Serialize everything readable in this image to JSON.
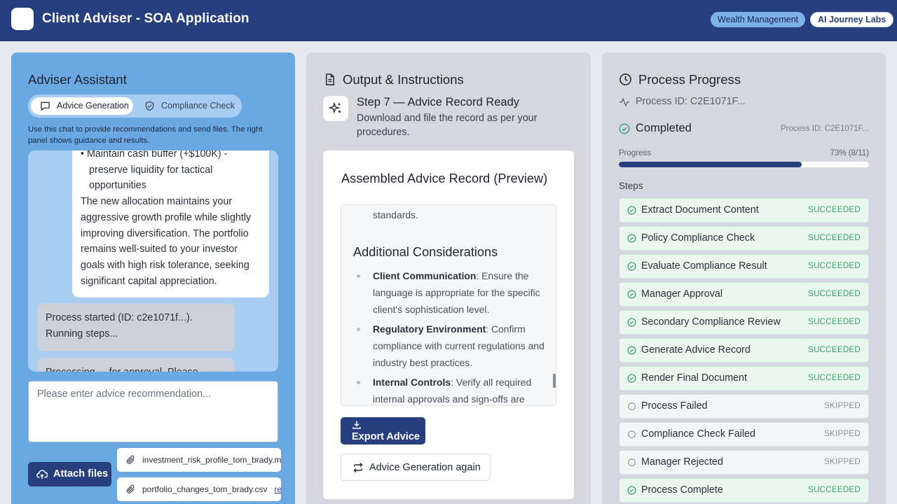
{
  "header": {
    "title": "Client Adviser - SOA Application",
    "badges": [
      "Wealth Management",
      "AI Journey Labs"
    ]
  },
  "left": {
    "title": "Adviser Assistant",
    "tabs": [
      {
        "label": "Advice Generation",
        "icon": "chat-icon",
        "active": true
      },
      {
        "label": "Compliance Check",
        "icon": "shield-icon",
        "active": false
      }
    ],
    "help": "Use this chat to provide recommendations and send files. The right panel shows guidance and results.",
    "chat": {
      "assistant_lines": [
        "• Maintain cash buffer (+$100K) - preserve liquidity for tactical opportunities",
        "The new allocation maintains your aggressive growth profile while slightly improving diversification. The portfolio remains well-suited to your investor goals with high risk tolerance, seeking significant capital appreciation."
      ],
      "user_messages": [
        "Process started (ID: c2e1071f...). Running steps...",
        "Processing ... for approval. Please"
      ]
    },
    "input_placeholder": "Please enter advice recommendation...",
    "attach_label": "Attach files",
    "files": [
      {
        "name": "investment_risk_profile_tom_brady.md",
        "action": ""
      },
      {
        "name": "portfolio_changes_tom_brady.csv",
        "action": "remove"
      }
    ]
  },
  "middle": {
    "title": "Output & Instructions",
    "step_title": "Step 7 — Advice Record Ready",
    "step_desc": "Download and file the record as per your procedures.",
    "record_title": "Assembled Advice Record (Preview)",
    "preview": {
      "lead": "standards.",
      "heading": "Additional Considerations",
      "items": [
        {
          "term": "Client Communication",
          "text": ": Ensure the language is appropriate for the specific client's sophistication level."
        },
        {
          "term": "Regulatory Environment",
          "text": ": Confirm compliance with current regulations and industry best practices."
        },
        {
          "term": "Internal Controls",
          "text": ": Verify all required internal approvals and sign-offs are"
        }
      ]
    },
    "export_label": "Export Advice",
    "again_label": "Advice Generation again"
  },
  "right": {
    "title": "Process Progress",
    "process_id": "Process ID: C2E1071F...",
    "status": "Completed",
    "status_id": "Process ID: C2E1071F...",
    "progress_label": "Progress",
    "progress_text": "73% (8/11)",
    "progress_fraction": 0.73,
    "steps_label": "Steps",
    "steps": [
      {
        "name": "Extract Document Content",
        "state": "SUCCEEDED"
      },
      {
        "name": "Policy Compliance Check",
        "state": "SUCCEEDED"
      },
      {
        "name": "Evaluate Compliance Result",
        "state": "SUCCEEDED"
      },
      {
        "name": "Manager Approval",
        "state": "SUCCEEDED"
      },
      {
        "name": "Secondary Compliance Review",
        "state": "SUCCEEDED"
      },
      {
        "name": "Generate Advice Record",
        "state": "SUCCEEDED"
      },
      {
        "name": "Render Final Document",
        "state": "SUCCEEDED"
      },
      {
        "name": "Process Failed",
        "state": "SKIPPED"
      },
      {
        "name": "Compliance Check Failed",
        "state": "SKIPPED"
      },
      {
        "name": "Manager Rejected",
        "state": "SKIPPED"
      },
      {
        "name": "Process Complete",
        "state": "SUCCEEDED"
      }
    ]
  },
  "colors": {
    "header": "#283f7f",
    "left_panel": "#69a8e3",
    "panel": "#d5d6e0",
    "accent": "#283f7f",
    "success": "#38a169"
  }
}
